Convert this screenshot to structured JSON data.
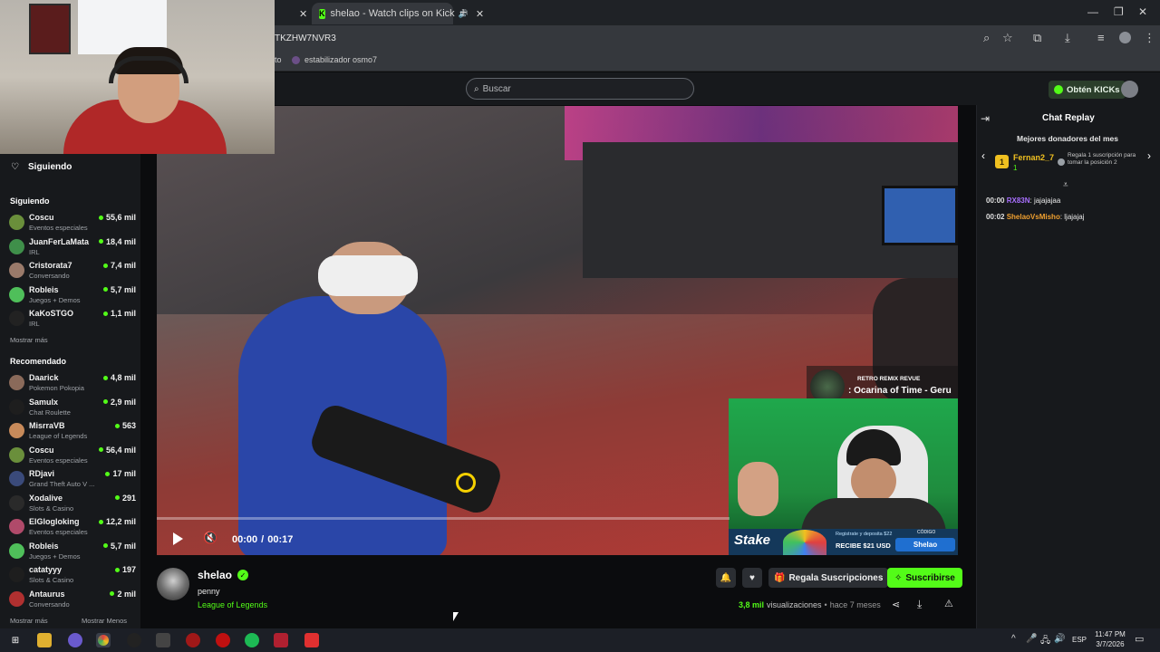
{
  "browser": {
    "tabs": [
      {
        "label": "",
        "active": false
      },
      {
        "label": "shelao - Watch clips on Kick",
        "active": true
      }
    ],
    "url_fragment": "TKZHW7NVR3",
    "bookmarks": [
      "to",
      "estabilizador osmo7"
    ]
  },
  "kick": {
    "search_placeholder": "Buscar",
    "get_kicks_label": "Obtén KICKs",
    "accent": "#53fc18"
  },
  "sidebar": {
    "following_label": "Siguiendo",
    "following_header": "Siguiendo",
    "following": [
      {
        "name": "Coscu",
        "category": "Eventos especiales",
        "viewers": "55,6 mil",
        "color": "#6a8f3b"
      },
      {
        "name": "JuanFerLaMata",
        "category": "IRL",
        "viewers": "18,4 mil",
        "color": "#3f8f4a"
      },
      {
        "name": "Cristorata7",
        "category": "Conversando",
        "viewers": "7,4 mil",
        "color": "#9a7a6a"
      },
      {
        "name": "Robleis",
        "category": "Juegos + Demos",
        "viewers": "5,7 mil",
        "color": "#4fbf5a"
      },
      {
        "name": "KaKoSTGO",
        "category": "IRL",
        "viewers": "1,1 mil",
        "color": "#222222"
      }
    ],
    "show_more_1": "Mostrar más",
    "recommended_header": "Recomendado",
    "recommended": [
      {
        "name": "Daarick",
        "category": "Pokemon Pokopia",
        "viewers": "4,8 mil",
        "color": "#8a6a5a"
      },
      {
        "name": "Samulx",
        "category": "Chat Roulette",
        "viewers": "2,9 mil",
        "color": "#1e1e1e"
      },
      {
        "name": "MisrraVB",
        "category": "League of Legends",
        "viewers": "563",
        "color": "#c78a5a"
      },
      {
        "name": "Coscu",
        "category": "Eventos especiales",
        "viewers": "56,4 mil",
        "color": "#6a8f3b"
      },
      {
        "name": "RDjavi",
        "category": "Grand Theft Auto V ...",
        "viewers": "17 mil",
        "color": "#3a4a7a"
      },
      {
        "name": "Xodalive",
        "category": "Slots & Casino",
        "viewers": "291",
        "color": "#2a2a2a"
      },
      {
        "name": "ElGlogloking",
        "category": "Eventos especiales",
        "viewers": "12,2 mil",
        "color": "#b04a6a"
      },
      {
        "name": "Robleis",
        "category": "Juegos + Demos",
        "viewers": "5,7 mil",
        "color": "#4fbf5a"
      },
      {
        "name": "catatyyy",
        "category": "Slots & Casino",
        "viewers": "197",
        "color": "#1e1e1e"
      },
      {
        "name": "Antaurus",
        "category": "Conversando",
        "viewers": "2 mil",
        "color": "#b03030"
      }
    ],
    "show_more_2": "Mostrar más",
    "show_less": "Mostrar Menos"
  },
  "player": {
    "time_current": "00:00",
    "time_sep": "/",
    "time_total": "00:17",
    "progress": 0,
    "overlay_title": "RETRO REMIX REVUE",
    "overlay_song": ": Ocarina of Time - Geru",
    "ad_brand": "Stake",
    "ad_text1": "Registrate y deposita $22",
    "ad_text2": "RECIBE $21 USD",
    "ad_code_label": "CÓDIGO",
    "ad_code": "Shelao"
  },
  "clip": {
    "channel": "shelao",
    "title": "penny",
    "category": "League of Legends",
    "views": "3,8 mil",
    "views_label": "visualizaciones",
    "age": "hace 7 meses",
    "gift_label": "Regala Suscripciones",
    "subscribe_label": "Suscribirse"
  },
  "chat": {
    "title": "Chat Replay",
    "top_donors_label": "Mejores donadores del mes",
    "donor_name": "Fernan2_7",
    "donor_amount": "1",
    "gift_hint": "Regala 1 suscripción para tomar la posición 2",
    "messages": [
      {
        "time": "00:00",
        "user": "RX83N",
        "text": ": jajajajaa",
        "color": "#a970ff"
      },
      {
        "time": "00:02",
        "user": "ShelaoVsMisho",
        "text": ": ljajajaj",
        "color": "#f0a030"
      }
    ]
  },
  "taskbar": {
    "lang": "ESP",
    "time": "11:47 PM",
    "date": "3/7/2026"
  }
}
